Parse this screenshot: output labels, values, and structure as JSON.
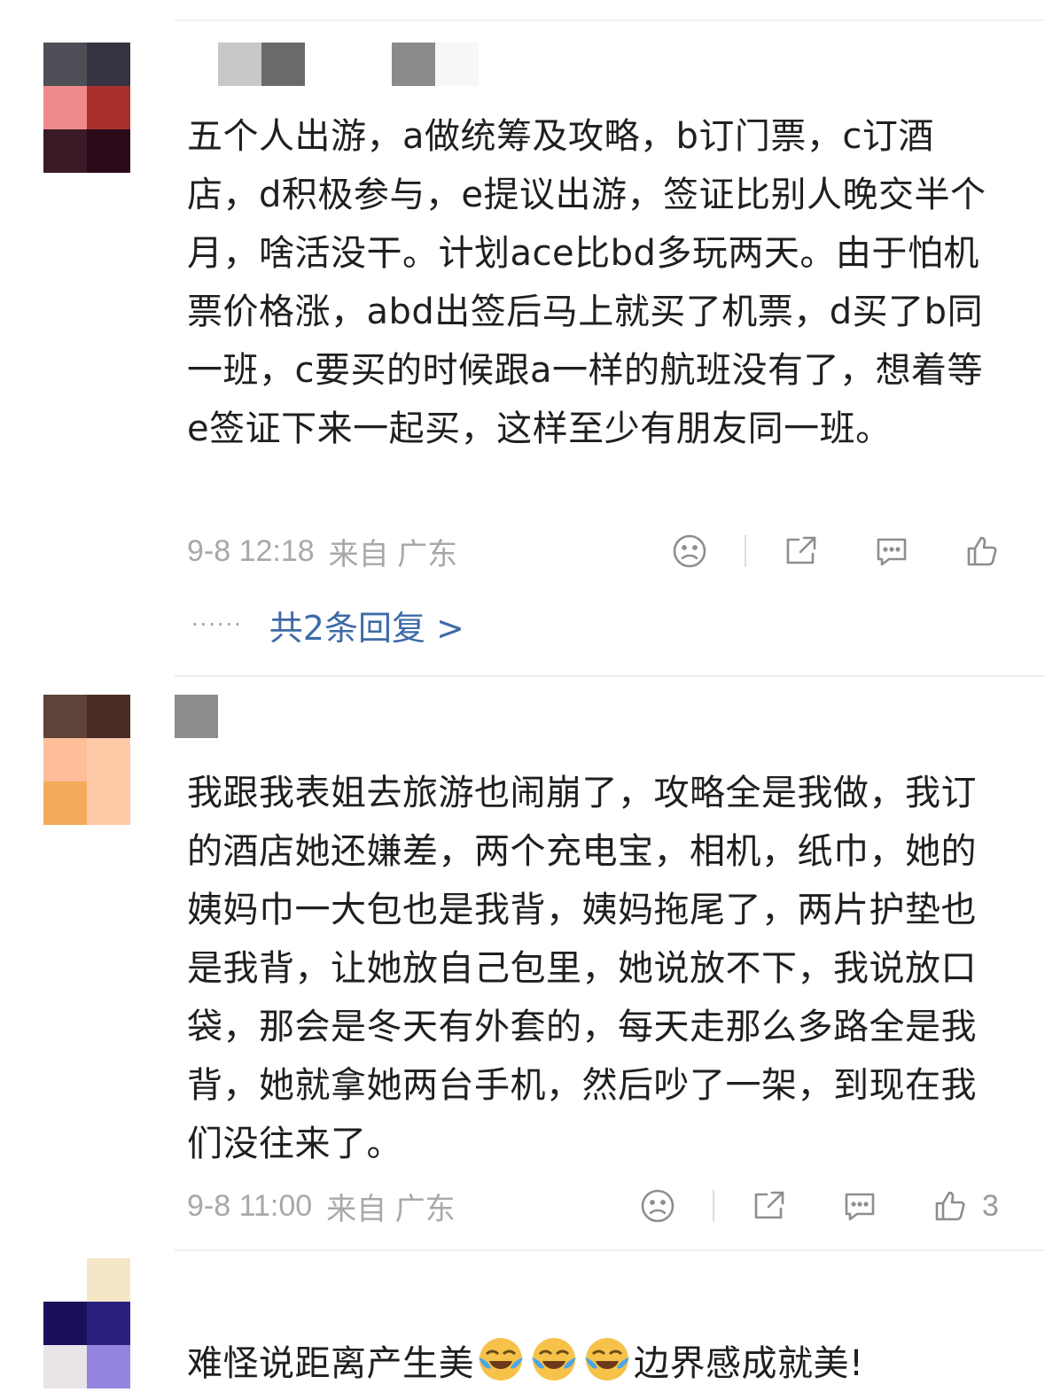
{
  "comments": [
    {
      "text": "五个人出游，a做统筹及攻略，b订门票，c订酒店，d积极参与，e提议出游，签证比别人晚交半个月，啥活没干。计划ace比bd多玩两天。由于怕机票价格涨，abd出签后马上就买了机票，d买了b同一班，c要买的时候跟a一样的航班没有了，想着等e签证下来一起买，这样至少有朋友同一班。",
      "time": "9-8 12:18",
      "from": "来自 广东",
      "likes": "",
      "replies_link": "共2条回复 >",
      "replies_dots": "······"
    },
    {
      "text": "我跟我表姐去旅游也闹崩了，攻略全是我做，我订的酒店她还嫌差，两个充电宝，相机，纸巾，她的姨妈巾一大包也是我背，姨妈拖尾了，两片护垫也是我背，让她放自己包里，她说放不下，我说放口袋，那会是冬天有外套的，每天走那么多路全是我背，她就拿她两台手机，然后吵了一架，到现在我们没往来了。",
      "time": "9-8 11:00",
      "from": "来自 广东",
      "likes": "3"
    },
    {
      "text_before": "难怪说距离产生美",
      "text_after": "边界感成就美!",
      "emoji_name": "crying-laughing-emoji"
    }
  ],
  "colors": {
    "text": "#1f1f1f",
    "meta": "#a8a8a8",
    "link": "#3d6ba8",
    "icon": "#8e8e8e"
  }
}
